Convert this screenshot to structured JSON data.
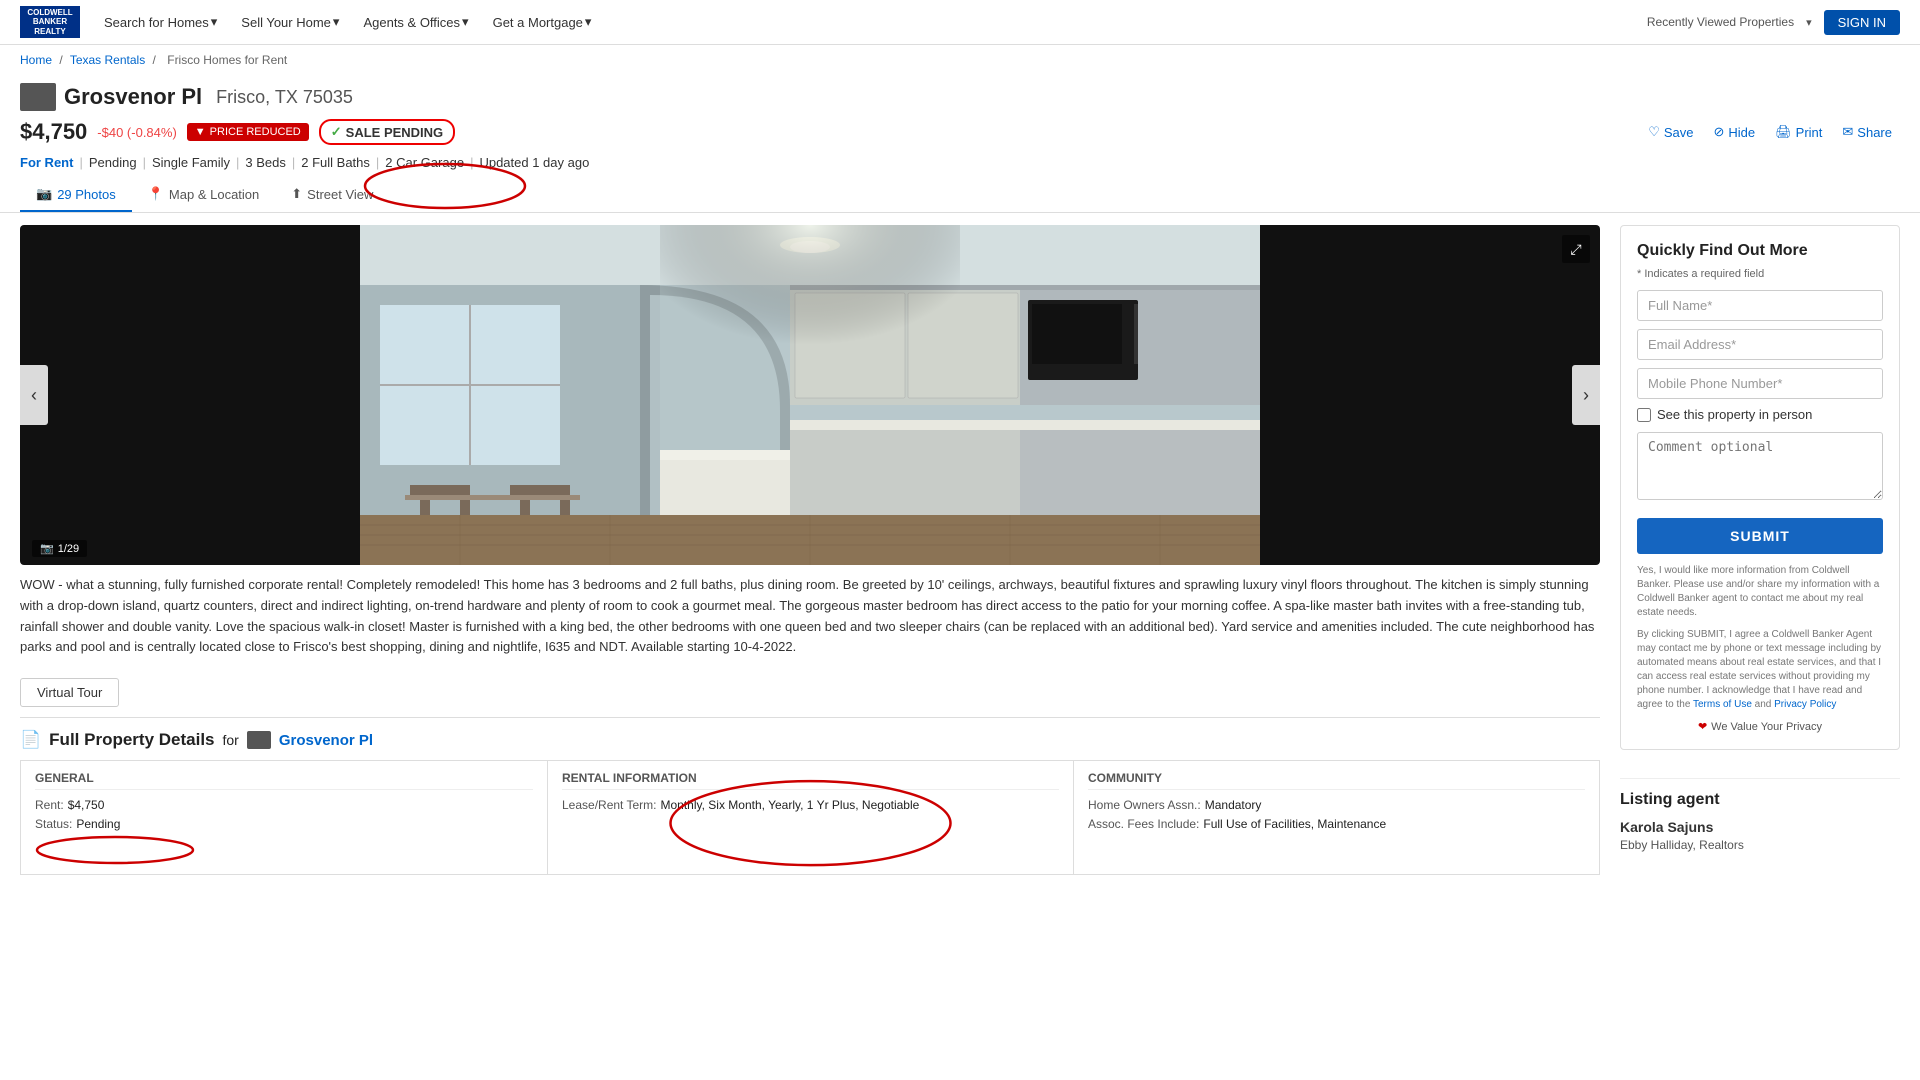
{
  "nav": {
    "logo_line1": "COLDWELL",
    "logo_line2": "BANKER",
    "logo_line3": "REALTY",
    "links": [
      "Search for Homes",
      "Sell Your Home",
      "Agents & Offices",
      "Get a Mortgage"
    ],
    "recently_viewed": "Recently Viewed Properties",
    "signin": "SIGN IN"
  },
  "breadcrumb": {
    "home": "Home",
    "texas": "Texas Rentals",
    "frisco": "Frisco Homes for Rent"
  },
  "property": {
    "icon_alt": "property-icon",
    "address": "Grosvenor Pl",
    "city_state_zip": "Frisco, TX 75035",
    "price": "$4,750",
    "price_change": "-$40 (-0.84%)",
    "badge_reduced": "PRICE REDUCED",
    "badge_sale_pending": "SALE PENDING",
    "actions": {
      "save": "Save",
      "hide": "Hide",
      "print": "Print",
      "share": "Share"
    }
  },
  "details": {
    "type": "For Rent",
    "status": "Pending",
    "style": "Single Family",
    "beds": "3 Beds",
    "baths": "2 Full Baths",
    "garage": "2 Car Garage",
    "updated": "Updated 1 day ago"
  },
  "tabs": {
    "photos": "29 Photos",
    "map": "Map & Location",
    "street": "Street View"
  },
  "photo": {
    "counter": "1/29",
    "counter_icon": "📷"
  },
  "form": {
    "title": "Quickly Find Out More",
    "required_note": "* Indicates a required field",
    "fullname_placeholder": "Full Name*",
    "email_placeholder": "Email Address*",
    "phone_placeholder": "Mobile Phone Number*",
    "checkbox_label": "See this property in person",
    "comment_placeholder": "Comment optional",
    "submit": "SUBMIT",
    "legal1": "Yes, I would like more information from Coldwell Banker. Please use and/or share my information with a Coldwell Banker agent to contact me about my real estate needs.",
    "legal2": "By clicking SUBMIT, I agree a Coldwell Banker Agent may contact me by phone or text message including by automated means about real estate services, and that I can access real estate services without providing my phone number. I acknowledge that I have read and agree to the",
    "terms_link": "Terms of Use",
    "and": "and",
    "privacy_link": "Privacy Policy",
    "privacy_badge": "❤",
    "privacy_text": "We Value Your Privacy"
  },
  "listing_agent": {
    "title": "Listing agent",
    "name": "Karola Sajuns",
    "company": "Ebby Halliday, Realtors"
  },
  "description": {
    "text": "WOW - what a stunning, fully furnished corporate rental! Completely remodeled! This home has 3 bedrooms and 2 full baths, plus dining room. Be greeted by 10' ceilings, archways, beautiful fixtures and sprawling luxury vinyl floors throughout. The kitchen is simply stunning with a drop-down island, quartz counters, direct and indirect lighting, on-trend hardware and plenty of room to cook a gourmet meal. The gorgeous master bedroom has direct access to the patio for your morning coffee. A spa-like master bath invites with a free-standing tub, rainfall shower and double vanity. Love the spacious walk-in closet! Master is furnished with a king bed, the other bedrooms with one queen bed and two sleeper chairs (can be replaced with an additional bed). Yard service and amenities included. The cute neighborhood has parks and pool and is centrally located close to Frisco's best shopping, dining and nightlife, I635 and NDT. Available starting 10-4-2022."
  },
  "virtual_tour": {
    "label": "Virtual Tour"
  },
  "full_property_details": {
    "title": "Full Property Details",
    "for_text": "for",
    "address_link": "Grosvenor Pl",
    "sections": {
      "general": {
        "title": "GENERAL",
        "rows": [
          {
            "label": "Rent:",
            "value": "$4,750"
          },
          {
            "label": "Status:",
            "value": "Pending"
          }
        ]
      },
      "rental_info": {
        "title": "RENTAL INFORMATION",
        "rows": [
          {
            "label": "Lease/Rent Term:",
            "value": "Monthly, Six Month, Yearly, 1 Yr Plus, Negotiable"
          }
        ]
      },
      "community": {
        "title": "COMMUNITY",
        "rows": [
          {
            "label": "Home Owners Assn.:",
            "value": "Mandatory"
          },
          {
            "label": "Assoc. Fees Include:",
            "value": "Full Use of Facilities, Maintenance"
          }
        ]
      }
    }
  }
}
